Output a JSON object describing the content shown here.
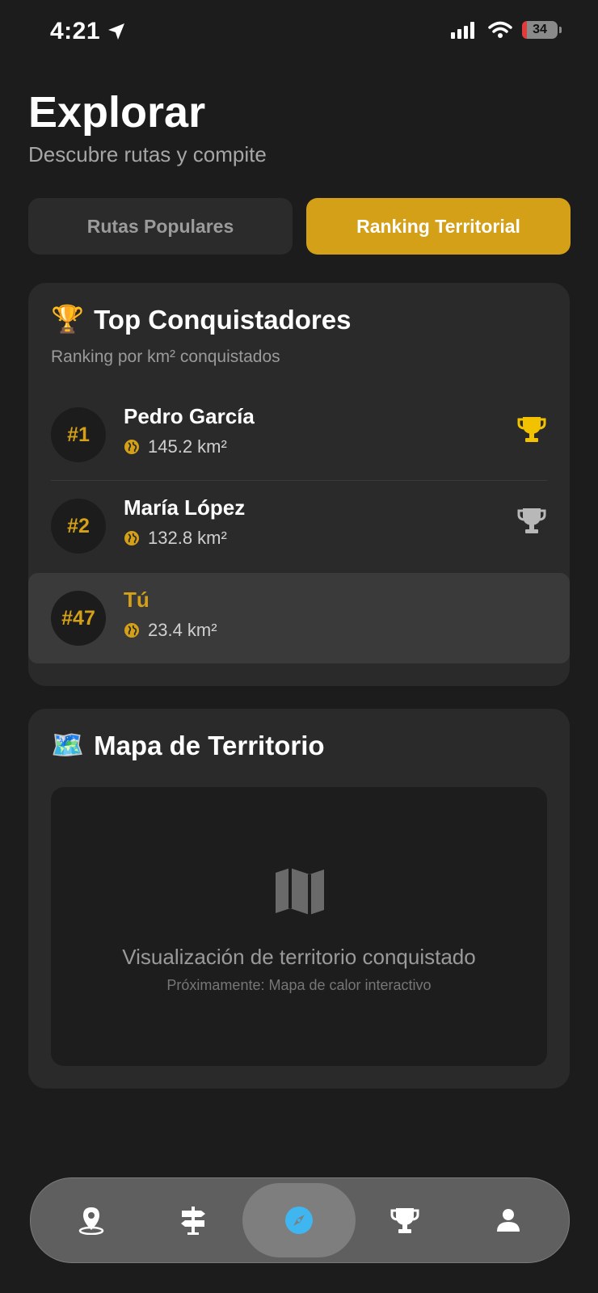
{
  "status_bar": {
    "time": "4:21",
    "battery": "34"
  },
  "header": {
    "title": "Explorar",
    "subtitle": "Descubre rutas y compite"
  },
  "tabs": [
    {
      "label": "Rutas Populares",
      "active": false
    },
    {
      "label": "Ranking Territorial",
      "active": true
    }
  ],
  "ranking": {
    "emoji": "🏆",
    "title": "Top Conquistadores",
    "subtitle": "Ranking por km² conquistados",
    "rows": [
      {
        "rank": "#1",
        "name": "Pedro García",
        "area": "145.2 km²",
        "trophy": "gold-trophy-icon"
      },
      {
        "rank": "#2",
        "name": "María López",
        "area": "132.8 km²",
        "trophy": "silver-trophy-icon"
      },
      {
        "rank": "#47",
        "name": "Tú",
        "area": "23.4 km²",
        "highlight": true
      }
    ]
  },
  "map_section": {
    "emoji": "🗺️",
    "title": "Mapa de Territorio",
    "placeholder_title": "Visualización de territorio conquistado",
    "placeholder_sub": "Próximamente: Mapa de calor interactivo"
  },
  "nav": {
    "items": [
      {
        "icon": "map-pin-icon"
      },
      {
        "icon": "signpost-icon"
      },
      {
        "icon": "compass-icon",
        "active": true
      },
      {
        "icon": "trophy-icon"
      },
      {
        "icon": "user-icon"
      }
    ]
  },
  "colors": {
    "accent": "#d4a017",
    "background": "#1c1c1c",
    "card": "#2a2a2a",
    "compass": "#3fb6f0"
  }
}
